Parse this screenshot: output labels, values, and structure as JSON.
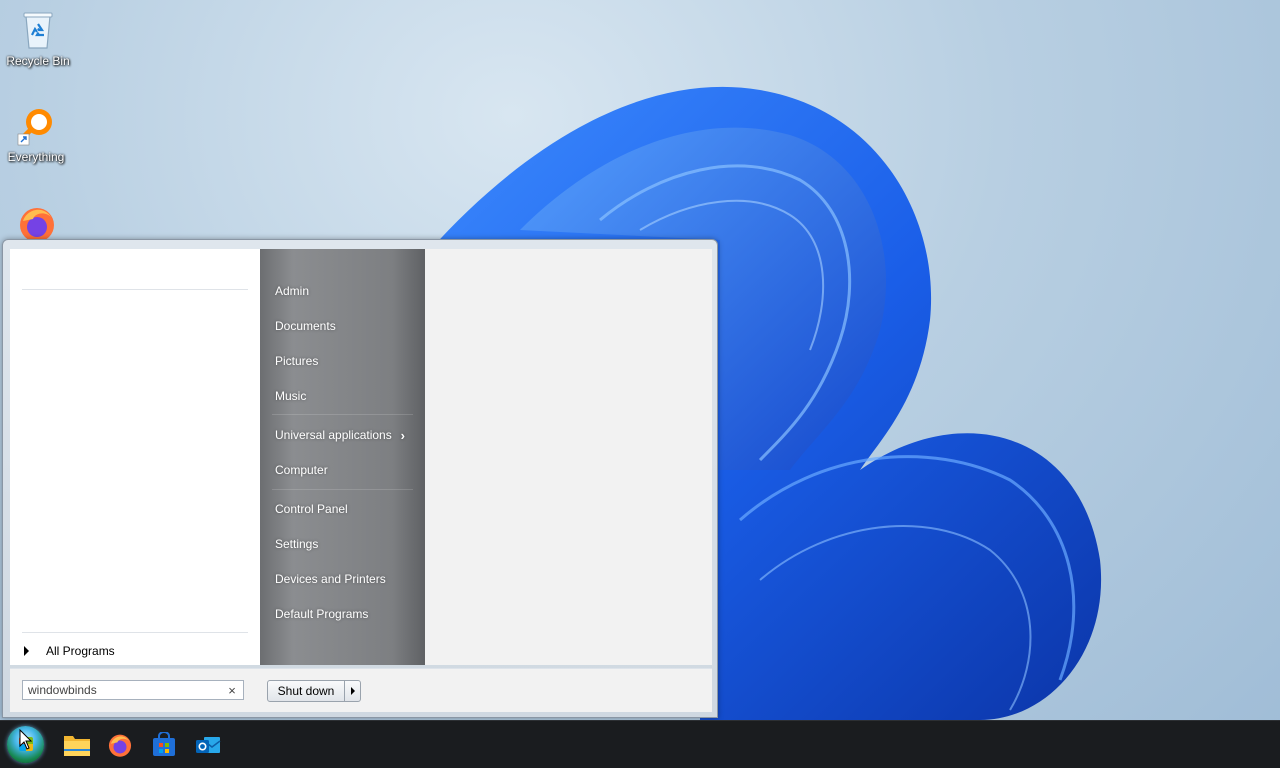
{
  "desktop": {
    "icons": [
      {
        "label": "Recycle Bin",
        "icon": "recycle-bin-icon"
      },
      {
        "label": "Everything",
        "icon": "everything-search-icon"
      },
      {
        "label": "",
        "icon": "firefox-icon"
      }
    ]
  },
  "start_menu": {
    "all_programs_label": "All Programs",
    "right_items": [
      {
        "label": "Admin"
      },
      {
        "label": "Documents"
      },
      {
        "label": "Pictures"
      },
      {
        "label": "Music"
      },
      {
        "label": "Universal applications",
        "submenu": true
      },
      {
        "label": "Computer"
      },
      {
        "label": "Control Panel"
      },
      {
        "label": "Settings"
      },
      {
        "label": "Devices and Printers"
      },
      {
        "label": "Default Programs"
      }
    ],
    "search": {
      "value": "windowbinds",
      "clear_glyph": "×"
    },
    "shutdown": {
      "label": "Shut down"
    }
  },
  "taskbar": {
    "start_button": "start-orb",
    "pinned": [
      "file-explorer-icon",
      "firefox-icon",
      "store-icon",
      "outlook-icon"
    ]
  },
  "colors": {
    "wallpaper_bloom": "#1a5ee8",
    "taskbar": "#1a1c1f",
    "right_pane": "#7d7f82"
  }
}
